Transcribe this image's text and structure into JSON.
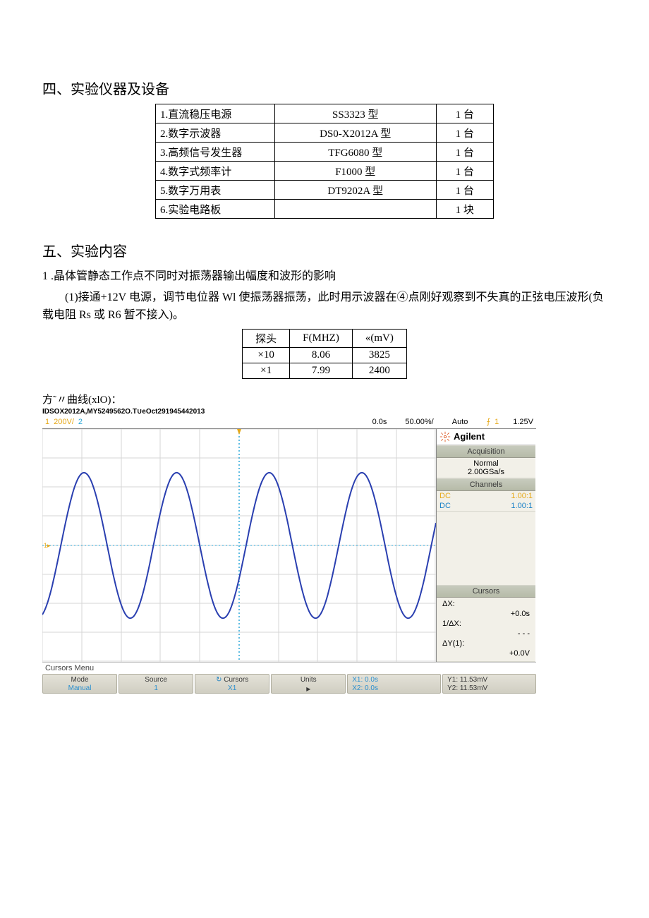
{
  "section4_title": "四、实验仪器及设备",
  "equipment": [
    {
      "no": "1.",
      "name": "直流稳压电源",
      "model": "SS3323 型",
      "qty": "1 台"
    },
    {
      "no": "2.",
      "name": "数字示波器",
      "model": "DS0-X2012A 型",
      "qty": "1 台"
    },
    {
      "no": "3.",
      "name": "高频信号发生器",
      "model": "TFG6080 型",
      "qty": "1 台"
    },
    {
      "no": "4.",
      "name": "数字式频率计",
      "model": "F1000 型",
      "qty": "1 台"
    },
    {
      "no": "5.",
      "name": "数字万用表",
      "model": "DT9202A 型",
      "qty": "1 台"
    },
    {
      "no": "6.",
      "name": "实验电路板",
      "model": "",
      "qty": "1 块"
    }
  ],
  "section5_title": "五、实验内容",
  "para1": "1 .晶体管静态工作点不同时对振荡器输出幅度和波形的影响",
  "para2": "(1)接通+12V 电源，调节电位器 Wl 使振荡器振荡，此时用示波器在④点刚好观察到不失真的正弦电压波形(负载电阻 Rs 或 R6 暂不接入)。",
  "data_table": {
    "headers": [
      "探头",
      "F(MHZ)",
      "«(mV)"
    ],
    "rows": [
      [
        "×10",
        "8.06",
        "3825"
      ],
      [
        "×1",
        "7.99",
        "2400"
      ]
    ]
  },
  "curve_label": "方˜〃曲线(xlO)：",
  "scope": {
    "info_line": "IDSOX2012A,MY5249562O.T∪eOct291945442013",
    "top": {
      "ch1_idx": "1",
      "ch1_scale": "200V/",
      "ch2_idx": "2",
      "time_pos": "0.0s",
      "time_scale": "50.00%/",
      "mode": "Auto",
      "trig_icon": "⨍",
      "trig_ch": "1",
      "trig_level": "1.25V"
    },
    "right": {
      "brand": "Agilent",
      "acq_title": "Acquisition",
      "acq_mode": "Normal",
      "acq_rate": "2.00GSa/s",
      "ch_title": "Channels",
      "ch1": {
        "coupling": "DC",
        "probe": "1.00:1"
      },
      "ch2": {
        "coupling": "DC",
        "probe": "1.00:1"
      },
      "cur_title": "Cursors",
      "dx_label": "ΔX:",
      "dx_val": "+0.0s",
      "invdx_label": "1/ΔX:",
      "invdx_val": "- - -",
      "dy_label": "ΔY(1):",
      "dy_val": "+0.0V"
    },
    "cursors_menu_label": "Cursors Menu",
    "softkeys": [
      {
        "l1": "Mode",
        "l2": "Manual"
      },
      {
        "l1": "Source",
        "l2": "1"
      },
      {
        "l1": "Cursors",
        "l2": "X1",
        "cycle": true
      },
      {
        "l1": "Units",
        "l2": "▸"
      },
      {
        "l1": "X1: 0.0s",
        "l2": "X2: 0.0s",
        "left": true,
        "blue": true
      },
      {
        "l1": "Y1: 11.53mV",
        "l2": "Y2: 11.53mV",
        "left": true
      }
    ]
  },
  "chart_data": {
    "type": "line",
    "title": "Oscilloscope waveform (Channel 1)",
    "description": "Sine wave, ~4.25 cycles across 10 horizontal divisions",
    "cycles_visible": 4.25,
    "amplitude_div": 2.5,
    "vertical_scale_label": "200V/",
    "horizontal_scale_label": "50.00%/",
    "trigger_level_label": "1.25V",
    "x_cursor_values": [
      "0.0s",
      "0.0s"
    ],
    "y_cursor_values": [
      "11.53mV",
      "11.53mV"
    ]
  }
}
